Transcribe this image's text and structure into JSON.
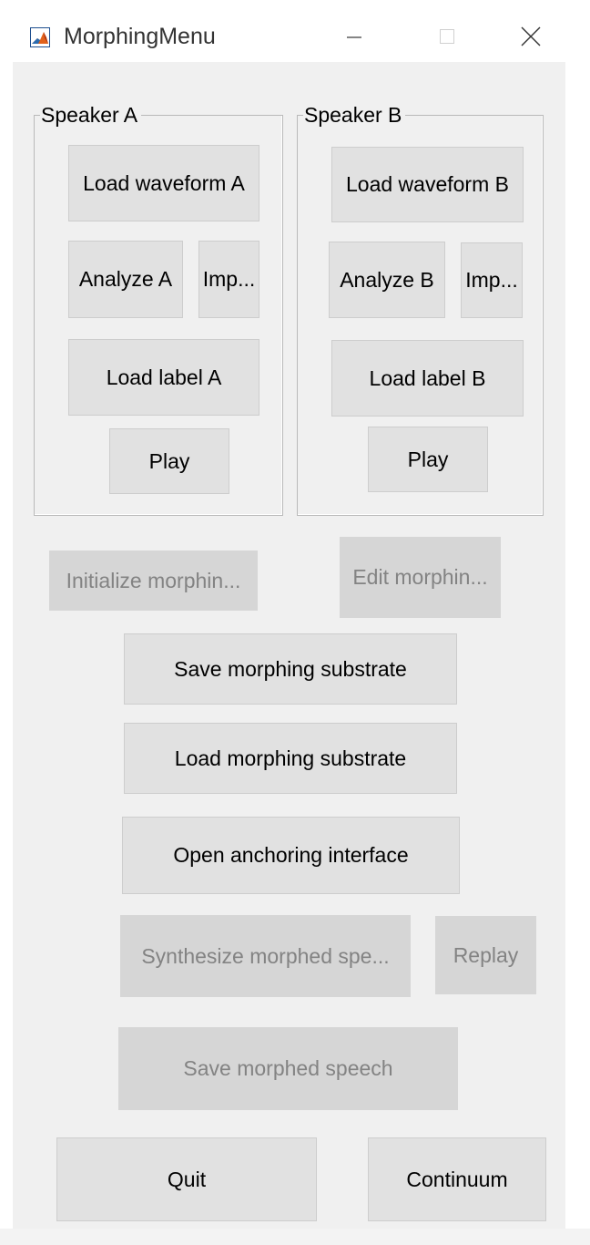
{
  "window": {
    "title": "MorphingMenu"
  },
  "speaker_a": {
    "title": "Speaker A",
    "load_waveform": "Load waveform A",
    "analyze": "Analyze A",
    "import": "Imp...",
    "load_label": "Load label A",
    "play": "Play"
  },
  "speaker_b": {
    "title": "Speaker B",
    "load_waveform": "Load waveform B",
    "analyze": "Analyze B",
    "import": "Imp...",
    "load_label": "Load label B",
    "play": "Play"
  },
  "actions": {
    "initialize_morphing": "Initialize morphin...",
    "edit_morphing": "Edit morphin...",
    "save_substrate": "Save morphing substrate",
    "load_substrate": "Load morphing substrate",
    "open_anchoring": "Open anchoring interface",
    "synthesize": "Synthesize morphed spe...",
    "replay": "Replay",
    "save_speech": "Save morphed speech",
    "quit": "Quit",
    "continuum": "Continuum"
  },
  "state": {
    "initialize_morphing_enabled": false,
    "edit_morphing_enabled": false,
    "synthesize_enabled": false,
    "replay_enabled": false,
    "save_speech_enabled": false
  },
  "icons": {
    "app": "matlab-icon",
    "minimize": "minimize-icon",
    "maximize": "maximize-icon",
    "close": "close-icon"
  },
  "colors": {
    "panel_background": "#f0f0f0",
    "button_face": "#e1e1e1",
    "disabled_button_face": "#d6d6d6",
    "disabled_text": "#838383"
  }
}
